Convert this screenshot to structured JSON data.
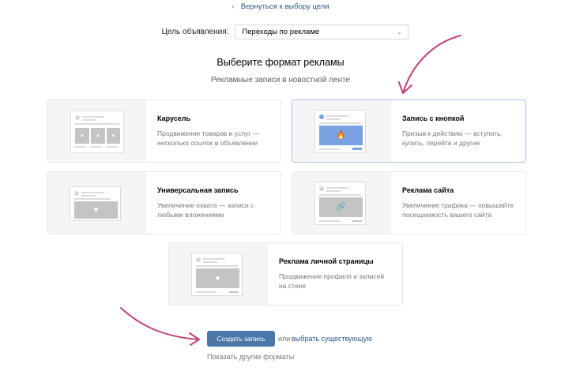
{
  "header": {
    "back_link": "Вернуться к выбору цели",
    "goal_label": "Цель объявления:",
    "goal_value": "Переходы по рекламе"
  },
  "main": {
    "title": "Выберите формат рекламы",
    "subtitle": "Рекламные записи в новостной ленте"
  },
  "formats": [
    {
      "name": "Карусель",
      "description": "Продвижение товаров и услуг — несколько ссылок в объявлении",
      "selected": false
    },
    {
      "name": "Запись с кнопкой",
      "description": "Призыв к действию — вступить, купить, перейти и другие",
      "selected": true
    },
    {
      "name": "Универсальная запись",
      "description": "Увеличение охвата — записи с любыми вложениями",
      "selected": false
    },
    {
      "name": "Реклама сайта",
      "description": "Увеличение трафика — повышайте посещаемость вашего сайта",
      "selected": false
    },
    {
      "name": "Реклама личной страницы",
      "description": "Продвижение профиля и записей на стене",
      "selected": false
    }
  ],
  "footer": {
    "create_label": "Создать запись",
    "or_text": "или",
    "choose_existing": "выбрать существующую",
    "show_other": "Показать другие форматы"
  },
  "colors": {
    "accent": "#4a76a8",
    "link": "#2a5885",
    "annotation_arrow": "#c0437a",
    "selected_border": "#a6c3e6"
  }
}
